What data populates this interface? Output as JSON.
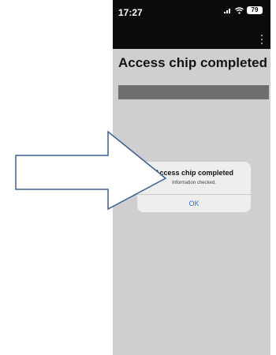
{
  "status_bar": {
    "time": "17:27",
    "battery": "79"
  },
  "app_bar": {
    "overflow_icon": "more-vert-icon"
  },
  "page": {
    "title": "Access chip completed",
    "progress": 1.0
  },
  "dialog": {
    "title": "Access chip completed",
    "message": "Information checked.",
    "ok_label": "OK"
  },
  "annotation": {
    "arrow_color": "#3b5f93"
  },
  "colors": {
    "status_bar_bg": "#0b0b0b",
    "screen_bg": "#cfcfcf",
    "progress_fill": "#6e6e6e",
    "dialog_bg": "#eeeeee",
    "ok_text": "#2a6fdb"
  }
}
